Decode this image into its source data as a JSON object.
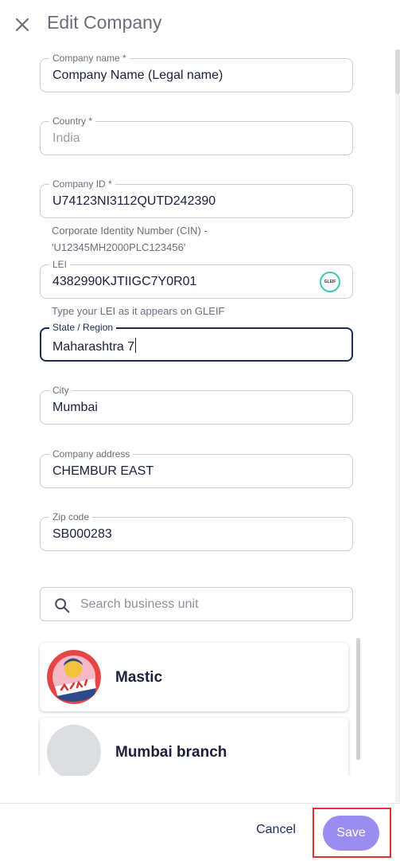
{
  "header": {
    "title": "Edit Company"
  },
  "fields": {
    "company_name": {
      "label": "Company name *",
      "value": "Company Name (Legal name)"
    },
    "country": {
      "label": "Country *",
      "value": "India"
    },
    "company_id": {
      "label": "Company ID *",
      "value": "U74123NI3112QUTD242390",
      "helper_line1": "Corporate Identity Number (CIN) -",
      "helper_line2": "'U12345MH2000PLC123456'"
    },
    "lei": {
      "label": "LEI",
      "value": "4382990KJTIIGC7Y0R01",
      "badge": "GLEIF",
      "helper": "Type your LEI as it appears on GLEIF"
    },
    "state": {
      "label": "State / Region",
      "value": "Maharashtra 7"
    },
    "city": {
      "label": "City",
      "value": "Mumbai"
    },
    "address": {
      "label": "Company address",
      "value": "CHEMBUR EAST"
    },
    "zip": {
      "label": "Zip code",
      "value": "SB000283"
    }
  },
  "search": {
    "placeholder": "Search business unit",
    "icon": "search-icon"
  },
  "business_units": [
    {
      "name": "Mastic",
      "avatar": "logo-avatar"
    },
    {
      "name": "Mumbai branch",
      "avatar": "placeholder-avatar"
    }
  ],
  "footer": {
    "cancel_label": "Cancel",
    "save_label": "Save"
  },
  "colors": {
    "primary": "#1e2a5a",
    "save_button": "#9b8cf0",
    "highlight": "#e03131",
    "gleif": "#3fc7b4"
  }
}
